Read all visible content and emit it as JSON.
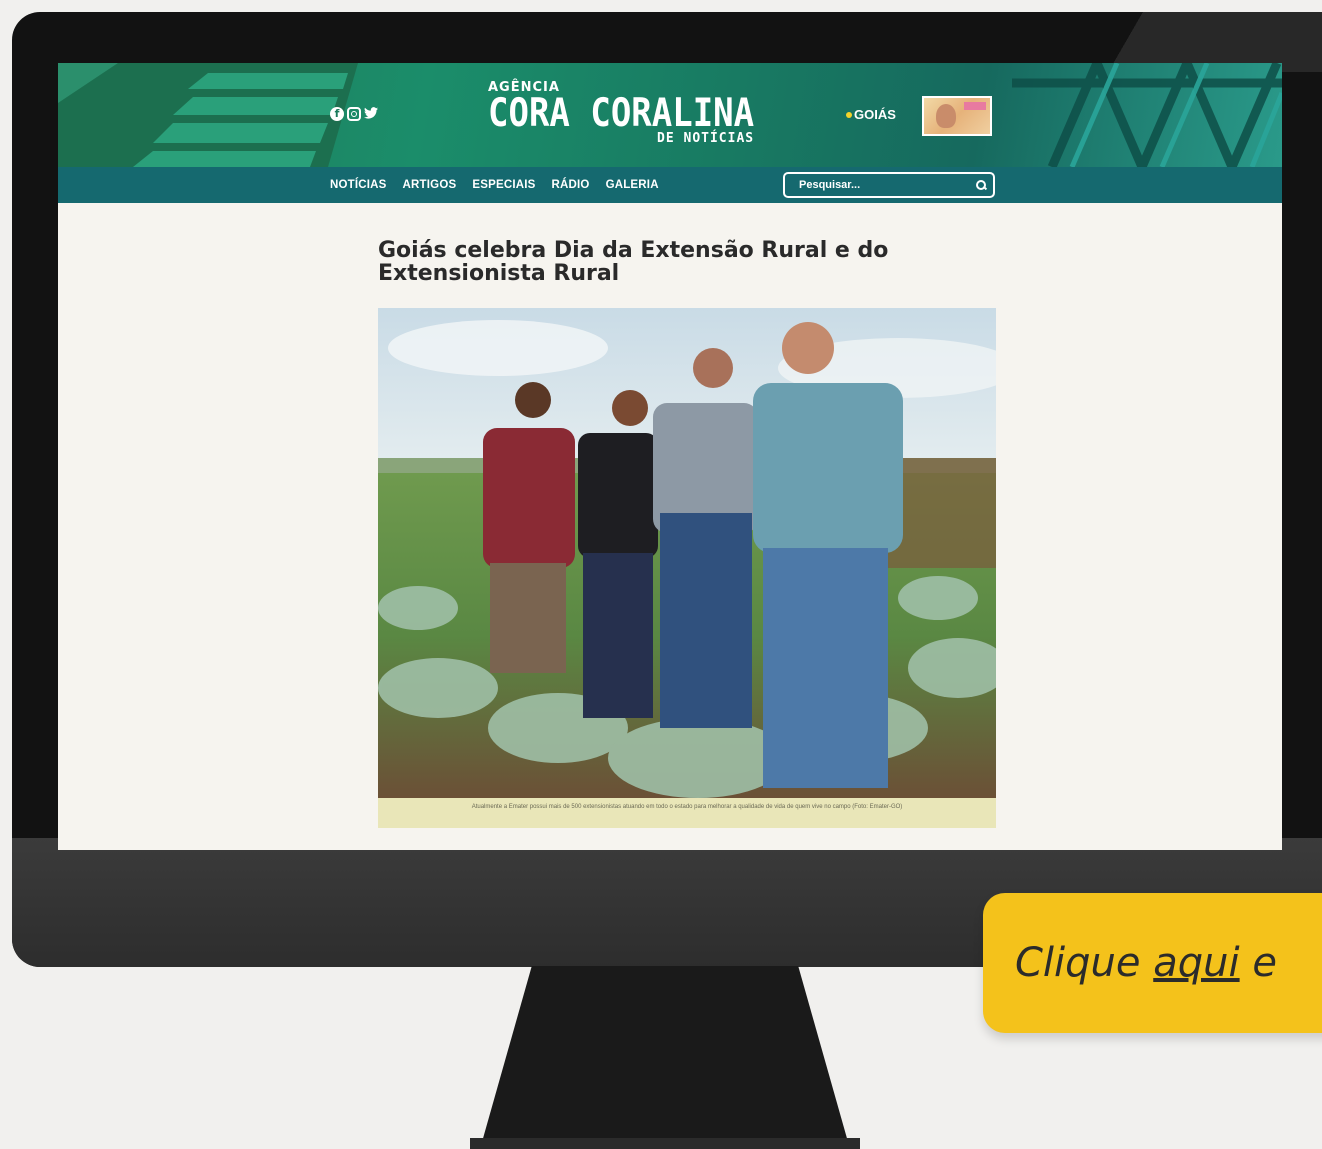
{
  "site": {
    "logo_top": "AGÊNCIA",
    "logo_main": "CORA CORALINA",
    "logo_sub": "DE NOTÍCIAS",
    "gov_label": "GOIÁS",
    "social_icons": [
      "facebook-icon",
      "instagram-icon",
      "twitter-icon"
    ],
    "brand_color": "#1b7a5c",
    "nav_color": "#15696f"
  },
  "nav": {
    "items": [
      {
        "label": "NOTÍCIAS"
      },
      {
        "label": "ARTIGOS"
      },
      {
        "label": "ESPECIAIS"
      },
      {
        "label": "RÁDIO"
      },
      {
        "label": "GALERIA"
      }
    ]
  },
  "search": {
    "placeholder": "Pesquisar...",
    "icon": "search-icon"
  },
  "article": {
    "title": "Goiás celebra Dia da Extensão Rural e do Extensionista Rural",
    "photo_description": "Four people standing in a vegetable field",
    "caption": "Atualmente a Emater possui mais de 500 extensionistas atuando em todo o estado para melhorar a qualidade de vida de quem vive no campo (Foto: Emater-GO)"
  },
  "cta": {
    "prefix": "Clique ",
    "link_text": "aqui",
    "suffix": " e",
    "color": "#f4c21b"
  }
}
